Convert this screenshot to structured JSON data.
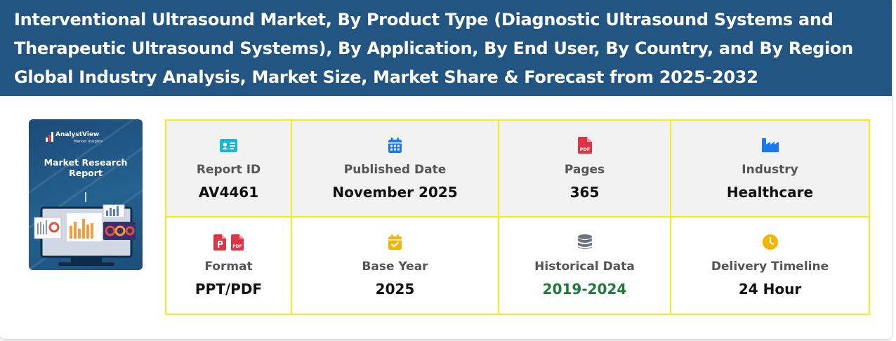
{
  "header": {
    "title": "Interventional Ultrasound Market, By Product Type (Diagnostic Ultrasound Systems and Therapeutic Ultrasound Systems), By Application, By End User, By Country, and By Region Global Industry Analysis, Market Size, Market Share & Forecast from 2025-2032"
  },
  "cover": {
    "brand": "AnalystView",
    "brand_sub": "Market Insights",
    "title_line1": "Market Research",
    "title_line2": "Report"
  },
  "details": [
    {
      "icon": "id-card-icon",
      "label": "Report ID",
      "value": "AV4461"
    },
    {
      "icon": "calendar-icon",
      "label": "Published Date",
      "value": "November 2025"
    },
    {
      "icon": "pdf-file-icon",
      "label": "Pages",
      "value": "365"
    },
    {
      "icon": "industry-icon",
      "label": "Industry",
      "value": "Healthcare"
    },
    {
      "icon": "ppt-pdf-icons",
      "label": "Format",
      "value": "PPT/PDF"
    },
    {
      "icon": "calendar-check-icon",
      "label": "Base Year",
      "value": "2025"
    },
    {
      "icon": "database-icon",
      "label": "Historical Data",
      "value": "2019-2024"
    },
    {
      "icon": "clock-icon",
      "label": "Delivery Timeline",
      "value": "24 Hour"
    }
  ],
  "colors": {
    "header_bg": "#225582",
    "table_border": "#f5ea1f",
    "id_icon": "#17b6d6",
    "calendar_icon": "#1877f2",
    "pdf_icon": "#dc3545",
    "industry_icon": "#1877f2",
    "base_year_icon": "#f5b400",
    "database_icon": "#6c757d",
    "clock_icon": "#f5b400",
    "historical_value": "#1f7a3a"
  }
}
